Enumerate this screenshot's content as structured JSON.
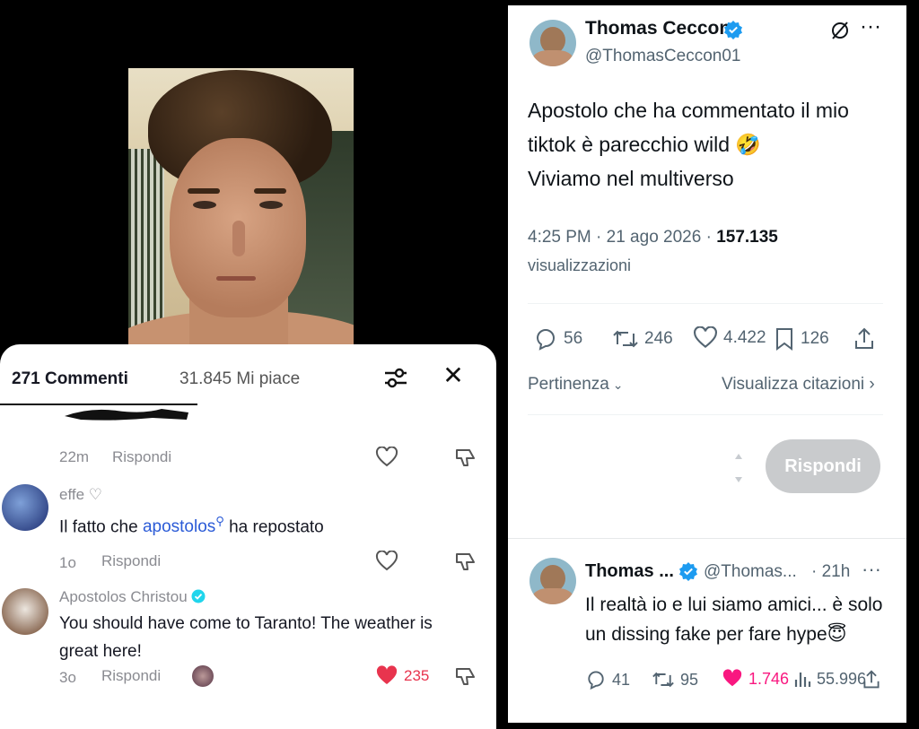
{
  "tiktok": {
    "comment_count": "271 Commenti",
    "likes_total": "31.845 Mi piace",
    "comments": [
      {
        "time": "22m",
        "reply_label": "Rispondi"
      },
      {
        "username": "effe",
        "text_before": "Il fatto che ",
        "mention": "apostolos",
        "text_after": " ha repostato",
        "time": "1o",
        "reply_label": "Rispondi"
      },
      {
        "username": "Apostolos Christou",
        "text": "You should have come to Taranto! The weather is great here!",
        "time": "3o",
        "reply_label": "Rispondi",
        "likes": "235"
      }
    ],
    "colors": {
      "like_red": "#e8344e",
      "link_blue": "#2b5bd7"
    }
  },
  "x_main": {
    "name": "Thomas Ceccon",
    "handle": "@ThomasCeccon01",
    "body_line1": "Apostolo che ha commentato il mio",
    "body_line2": "tiktok è parecchio wild 🤣",
    "body_line3": "Viviamo nel multiverso",
    "timestamp": "4:25 PM · 21 ago 2026 · ",
    "views_count": "157.135",
    "views_label": "visualizzazioni",
    "replies": "56",
    "reposts": "246",
    "likes": "4.422",
    "bookmarks": "126",
    "sort_label": "Pertinenza",
    "quotes_label": "Visualizza citazioni",
    "reply_button": "Rispondi",
    "verified_color": "#1d9bf0"
  },
  "x_reply": {
    "name": "Thomas ...",
    "handle": "@Thomas...",
    "age": "· 21h",
    "line1": "Il realtà io e lui siamo amici... è solo",
    "line2": "un dissing fake per fare hype😇",
    "replies": "41",
    "reposts": "95",
    "likes": "1.746",
    "views": "55.996",
    "like_color": "#f91880"
  }
}
